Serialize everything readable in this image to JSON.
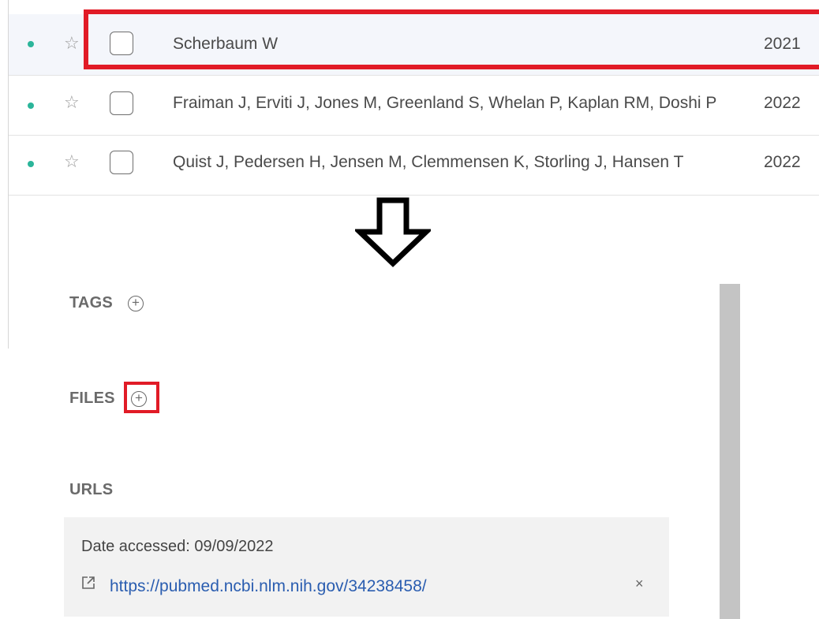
{
  "references": [
    {
      "authors": "Scherbaum W",
      "year": "2021"
    },
    {
      "authors": "Fraiman J, Erviti J, Jones M, Greenland S, Whelan P, Kaplan RM, Doshi P",
      "year": "2022"
    },
    {
      "authors": "Quist J, Pedersen H, Jensen M, Clemmensen K, Storling J, Hansen T",
      "year": "2022"
    }
  ],
  "sections": {
    "tags": "TAGS",
    "files": "FILES",
    "urls": "URLS"
  },
  "url_entry": {
    "date_accessed": "Date accessed: 09/09/2022",
    "url": "https://pubmed.ncbi.nlm.nih.gov/34238458/"
  },
  "icons": {
    "status_dot": "status-dot",
    "star": "star-icon",
    "add": "add-circle-icon",
    "external_link": "external-link-icon",
    "remove": "close-icon",
    "arrow": "down-arrow-icon"
  },
  "colors": {
    "status_dot": "#2bb59a",
    "highlight": "#e11b26",
    "link": "#2a5db0"
  }
}
